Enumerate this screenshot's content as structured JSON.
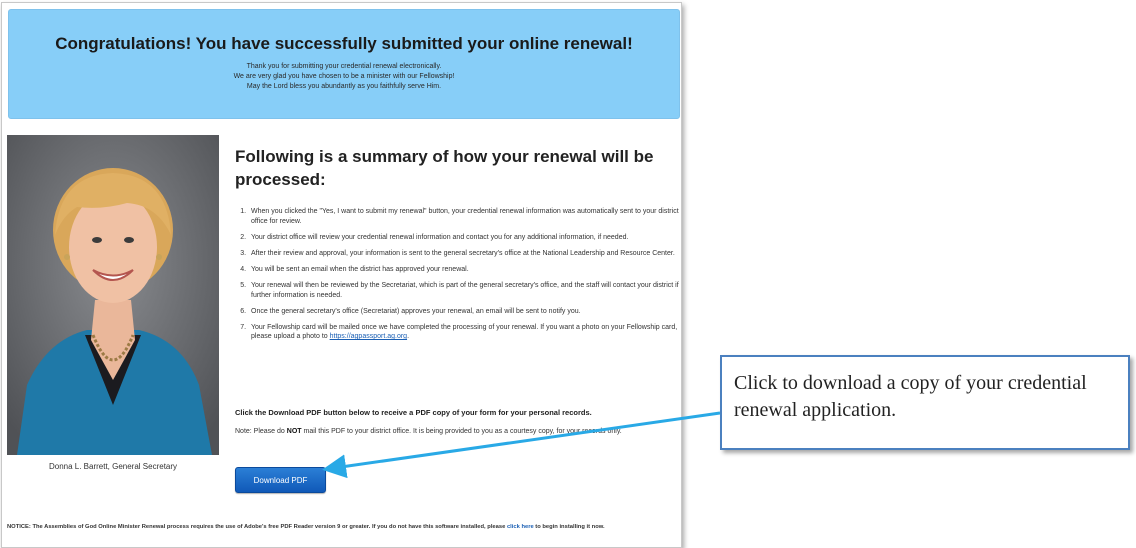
{
  "banner": {
    "title": "Congratulations! You have successfully submitted your online renewal!",
    "line1": "Thank you for submitting your credential renewal electronically.",
    "line2": "We are very glad you have chosen to be a minister with our Fellowship!",
    "line3": "May the Lord bless you abundantly as you faithfully serve Him."
  },
  "photo": {
    "caption": "Donna L. Barrett, General Secretary"
  },
  "summary": {
    "title": "Following is a summary of how your renewal will be processed:",
    "steps": [
      "When you clicked the \"Yes, I want to submit my renewal\" button, your credential renewal information was automatically sent to your district office for review.",
      "Your district office will review your credential renewal information and contact you for any additional information, if needed.",
      "After their review and approval, your information is sent to the general secretary's office at the National Leadership and Resource Center.",
      "You will be sent an email when the district has approved your renewal.",
      "Your renewal will then be reviewed by the Secretariat, which is part of the general secretary's office, and the staff will contact your district if further information is needed.",
      "Once the general secretary's office (Secretariat) approves your renewal, an email will be sent to notify you.",
      "Your Fellowship card will be mailed once we have completed the processing of your renewal. If you want a photo on your Fellowship card, please upload a photo to "
    ],
    "link_text": "https://agpassport.ag.org",
    "link_after": "."
  },
  "pdf": {
    "instruction": "Click the Download PDF button below to receive a PDF copy of your form for your personal records.",
    "note_prefix": "Note: Please do ",
    "note_bold": "NOT",
    "note_suffix": " mail this PDF to your district office. It is being provided to you as a courtesy copy, for your records only.",
    "button_label": "Download PDF"
  },
  "notice": {
    "prefix": "NOTICE: The Assemblies of God Online Minister Renewal process requires the use of Adobe's free PDF Reader version 9 or greater. If you do not have this software installed, please ",
    "link_text": "click here",
    "suffix": " to begin installing it now."
  },
  "callout": {
    "text": "Click to download a copy of your credential renewal application."
  },
  "colors": {
    "banner_bg": "#87cef8",
    "button_bg": "#1a6ccb",
    "callout_border": "#4b80bf",
    "arrow": "#29a9e6"
  }
}
